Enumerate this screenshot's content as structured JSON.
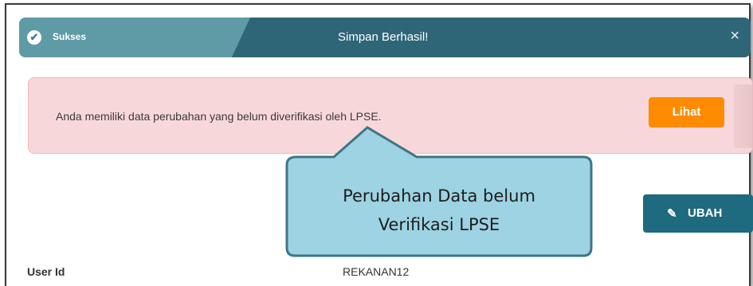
{
  "toast": {
    "status_label": "Sukses",
    "title": "Simpan Berhasil!",
    "close_glyph": "×",
    "check_glyph": "✔"
  },
  "alert": {
    "message": "Anda memiliki data perubahan yang belum diverifikasi oleh LPSE.",
    "button_label": "Lihat"
  },
  "edit_button": {
    "icon_glyph": "✎",
    "label": "UBAH"
  },
  "callout": {
    "line1": "Perubahan Data belum",
    "line2": "Verifikasi LPSE"
  },
  "fields": {
    "user_id_label": "User Id",
    "user_id_value": "REKANAN12"
  }
}
